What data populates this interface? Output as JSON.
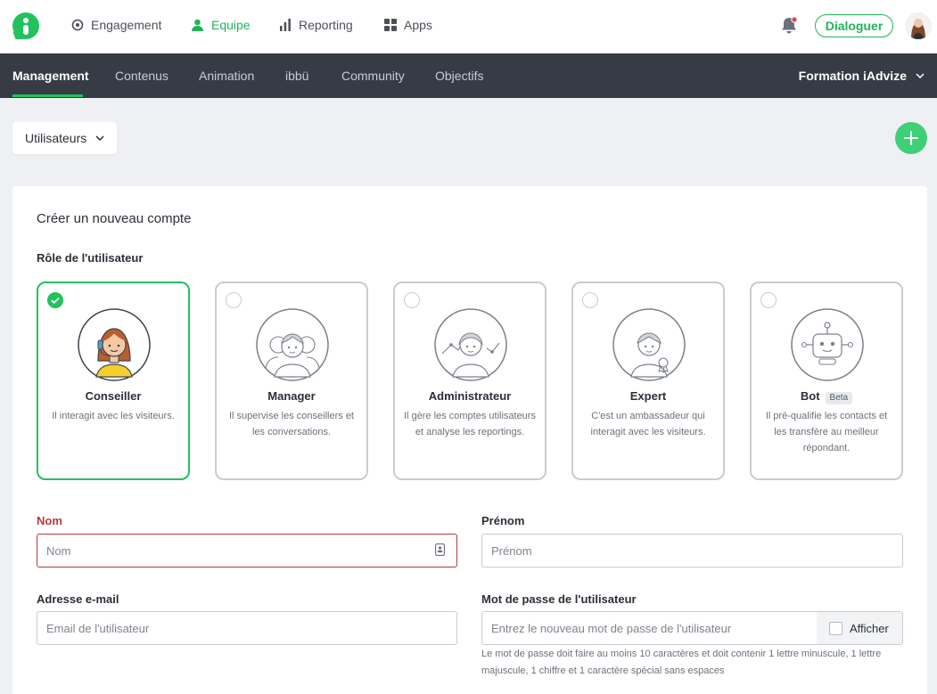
{
  "topnav": {
    "items": [
      {
        "label": "Engagement",
        "icon": "target-icon"
      },
      {
        "label": "Equipe",
        "icon": "user-icon",
        "active": true
      },
      {
        "label": "Reporting",
        "icon": "bar-chart-icon"
      },
      {
        "label": "Apps",
        "icon": "grid-icon"
      }
    ],
    "dialoguer_label": "Dialoguer",
    "accent_color": "#21c25e"
  },
  "subnav": {
    "items": [
      {
        "label": "Management",
        "active": true
      },
      {
        "label": "Contenus"
      },
      {
        "label": "Animation"
      },
      {
        "label": "ibbü"
      },
      {
        "label": "Community"
      },
      {
        "label": "Objectifs"
      }
    ],
    "org_label": "Formation iAdvize"
  },
  "selector": {
    "label": "Utilisateurs"
  },
  "form": {
    "title": "Créer un nouveau compte",
    "role_label": "Rôle de l'utilisateur",
    "roles": [
      {
        "name": "Conseiller",
        "desc": "Il interagit avec les visiteurs.",
        "selected": true
      },
      {
        "name": "Manager",
        "desc": "Il supervise les conseillers et les conversations."
      },
      {
        "name": "Administrateur",
        "desc": "Il gère les comptes utilisateurs et analyse les reportings."
      },
      {
        "name": "Expert",
        "desc": "C'est un ambassadeur qui interagit avec les visiteurs."
      },
      {
        "name": "Bot",
        "badge": "Beta",
        "desc": "Il pré-qualifie les contacts et les transfère au meilleur répondant."
      }
    ],
    "nom": {
      "label": "Nom",
      "placeholder": "Nom",
      "value": ""
    },
    "prenom": {
      "label": "Prénom",
      "placeholder": "Prénom",
      "value": ""
    },
    "email": {
      "label": "Adresse e-mail",
      "placeholder": "Email de l'utilisateur",
      "value": ""
    },
    "password": {
      "label": "Mot de passe de l'utilisateur",
      "placeholder": "Entrez le nouveau mot de passe de l'utilisateur",
      "value": "",
      "show_label": "Afficher",
      "help": "Le mot de passe doit faire au moins 10 caractères et doit contenir 1 lettre minuscule, 1 lettre majuscule, 1 chiffre et 1 caractère spécial sans espaces"
    }
  }
}
